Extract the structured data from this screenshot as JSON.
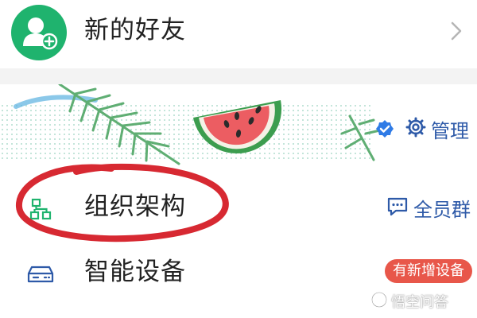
{
  "new_friends": {
    "label": "新的好友",
    "icon": "add-contact-icon",
    "chevron_icon": "chevron-right-icon"
  },
  "team": {
    "verified_icon": "verified-badge-icon",
    "manage_icon": "gear-icon",
    "manage_label": "管理"
  },
  "org_structure": {
    "label": "组织架构",
    "icon": "org-chart-icon",
    "group_icon": "chat-bubble-icon",
    "group_label": "全员群"
  },
  "smart_devices": {
    "label": "智能设备",
    "icon": "device-icon",
    "badge": "有新增设备"
  },
  "watermark": {
    "text": "悟空问答"
  },
  "colors": {
    "avatar_green": "#1fb36e",
    "accent_blue": "#2e5aa8",
    "badge_red": "#e8574a",
    "annotation_red": "#d3121c"
  }
}
